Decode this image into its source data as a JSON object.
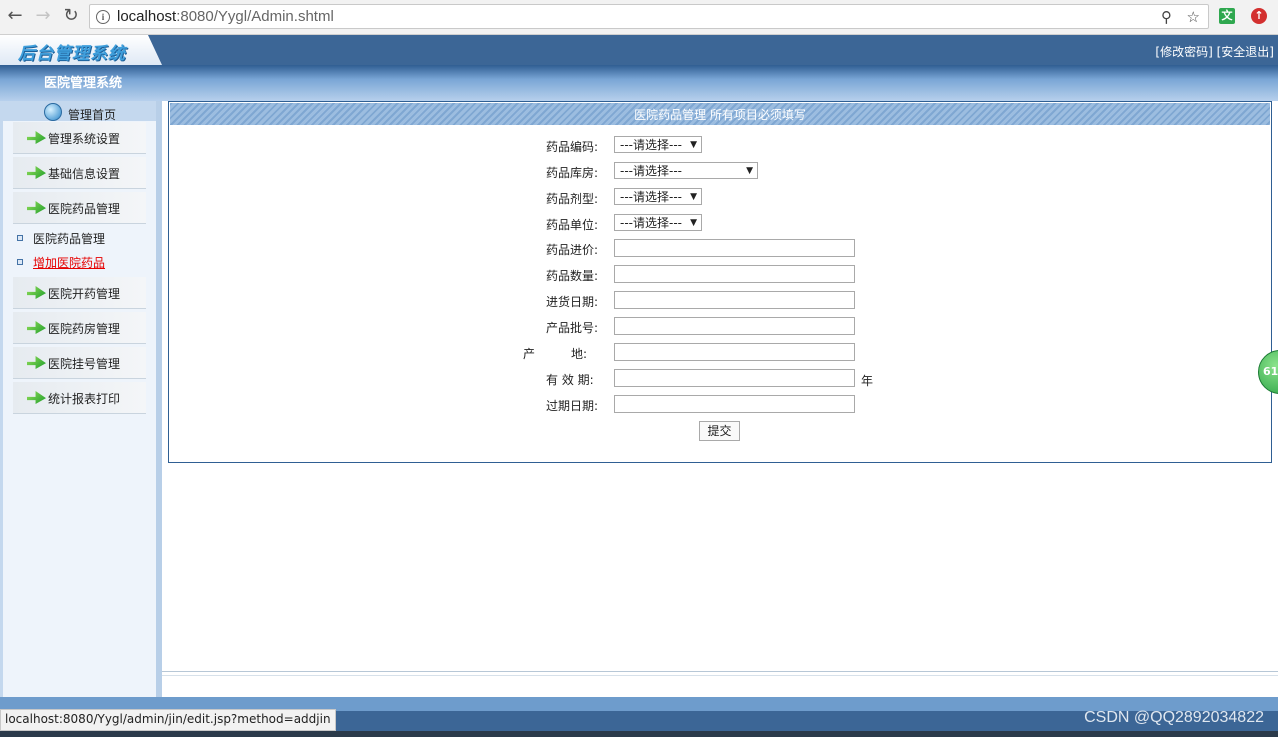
{
  "browser": {
    "url_host": "localhost",
    "url_rest": ":8080/Yygl/Admin.shtml",
    "translate_ext_label": "文"
  },
  "header": {
    "logo": "后台管理系统",
    "change_password": "[修改密码]",
    "logout": "[安全退出]",
    "system_title": "医院管理系统"
  },
  "sidebar": {
    "home": "管理首页",
    "items": [
      {
        "label": "管理系统设置"
      },
      {
        "label": "基础信息设置"
      },
      {
        "label": "医院药品管理"
      },
      {
        "label": "医院开药管理"
      },
      {
        "label": "医院药房管理"
      },
      {
        "label": "医院挂号管理"
      },
      {
        "label": "统计报表打印"
      }
    ],
    "sub_items": [
      {
        "label": "医院药品管理"
      },
      {
        "label": "增加医院药品"
      }
    ]
  },
  "form": {
    "title": "医院药品管理 所有项目必须填写",
    "fields": {
      "code": {
        "label": "药品编码:",
        "value": "---请选择---"
      },
      "store": {
        "label": "药品库房:",
        "value": "---请选择---"
      },
      "dosage": {
        "label": "药品剂型:",
        "value": "---请选择---"
      },
      "unit": {
        "label": "药品单位:",
        "value": "---请选择---"
      },
      "price": {
        "label": "药品进价:"
      },
      "quantity": {
        "label": "药品数量:"
      },
      "purchase_date": {
        "label": "进货日期:"
      },
      "batch": {
        "label": "产品批号:"
      },
      "origin": {
        "label": "产　　　地:"
      },
      "validity": {
        "label": "有 效 期:",
        "suffix": "年"
      },
      "expiry": {
        "label": "过期日期:"
      }
    },
    "submit": "提交"
  },
  "status_bar": {
    "url": "localhost:8080/Yygl/admin/jin/edit.jsp?method=addjin"
  },
  "overlay": {
    "badge": "61",
    "watermark": "CSDN @QQ2892034822"
  }
}
